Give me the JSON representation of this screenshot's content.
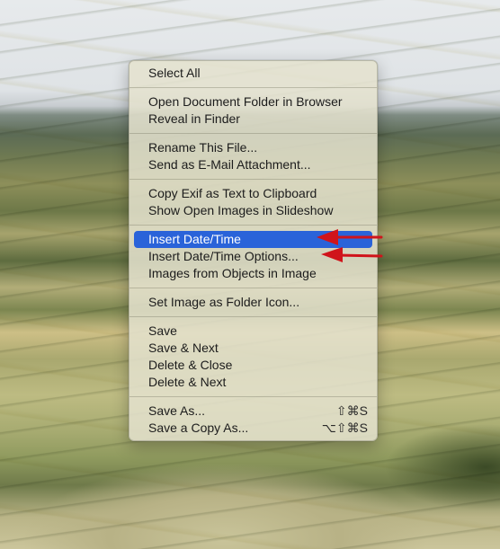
{
  "menu": {
    "groups": [
      [
        {
          "label": "Select All"
        }
      ],
      [
        {
          "label": "Open Document Folder in Browser"
        },
        {
          "label": "Reveal in Finder"
        }
      ],
      [
        {
          "label": "Rename This File..."
        },
        {
          "label": "Send as E-Mail Attachment..."
        }
      ],
      [
        {
          "label": "Copy Exif as Text to Clipboard"
        },
        {
          "label": "Show Open Images in Slideshow"
        }
      ],
      [
        {
          "label": "Insert Date/Time",
          "highlighted": true
        },
        {
          "label": "Insert Date/Time Options..."
        },
        {
          "label": "Images from Objects in Image"
        }
      ],
      [
        {
          "label": "Set Image as Folder Icon..."
        }
      ],
      [
        {
          "label": "Save"
        },
        {
          "label": "Save & Next"
        },
        {
          "label": "Delete & Close"
        },
        {
          "label": "Delete & Next"
        }
      ],
      [
        {
          "label": "Save As...",
          "shortcut": "⇧⌘S"
        },
        {
          "label": "Save a Copy As...",
          "shortcut": "⌥⇧⌘S"
        }
      ]
    ]
  },
  "colors": {
    "highlight": "#2a63d9",
    "annotation_arrow": "#d0141b"
  }
}
